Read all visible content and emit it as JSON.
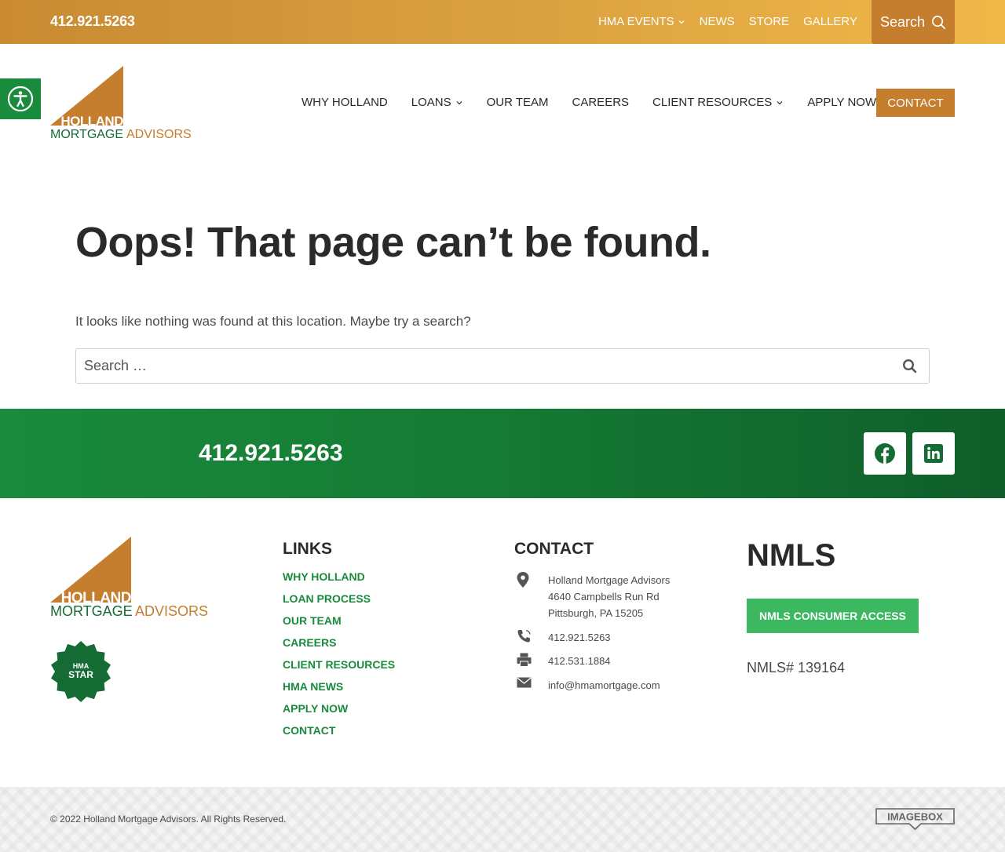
{
  "topbar": {
    "phone": "412.921.5263",
    "nav": [
      {
        "label": "HMA EVENTS",
        "has_dropdown": true
      },
      {
        "label": "NEWS",
        "has_dropdown": false
      },
      {
        "label": "STORE",
        "has_dropdown": false
      },
      {
        "label": "GALLERY",
        "has_dropdown": false
      }
    ],
    "search_label": "Search",
    "search_icon": "search-icon"
  },
  "header": {
    "logo": {
      "word1": "HOLLAND",
      "word2": "MORTGAGE",
      "word3": "ADVISORS"
    },
    "nav": [
      {
        "label": "WHY HOLLAND",
        "has_dropdown": false
      },
      {
        "label": "LOANS",
        "has_dropdown": true
      },
      {
        "label": "OUR TEAM",
        "has_dropdown": false
      },
      {
        "label": "CAREERS",
        "has_dropdown": false
      },
      {
        "label": "CLIENT RESOURCES",
        "has_dropdown": true
      },
      {
        "label": "APPLY NOW",
        "has_dropdown": false
      }
    ],
    "contact_label": "CONTACT",
    "accessibility_icon": "accessibility-icon"
  },
  "main": {
    "title": "Oops! That page can’t be found.",
    "text": "It looks like nothing was found at this location. Maybe try a search?",
    "search_placeholder": "Search …"
  },
  "band": {
    "phone": "412.921.5263",
    "social": [
      "facebook-icon",
      "linkedin-icon"
    ]
  },
  "footer": {
    "links_title": "LINKS",
    "links": [
      "WHY HOLLAND",
      "LOAN PROCESS",
      "OUR TEAM",
      "CAREERS",
      "CLIENT RESOURCES",
      "HMA NEWS",
      "APPLY NOW",
      "CONTACT"
    ],
    "contact_title": "CONTACT",
    "address": [
      "Holland Mortgage Advisors",
      "4640 Campbells Run Rd",
      "Pittsburgh, PA 15205"
    ],
    "phone": "412.921.5263",
    "fax": "412.531.1884",
    "email": "info@hmamortgage.com",
    "nmls_title": "NMLS",
    "nmls_button": "NMLS CONSUMER ACCESS",
    "nmls_number": "NMLS# 139164",
    "badge": {
      "line1": "HMA",
      "line2": "STAR"
    }
  },
  "bottom": {
    "copyright": "© 2022 Holland Mortgage Advisors. All Rights Reserved.",
    "credit": "IMAGEBOX"
  },
  "colors": {
    "gold": "#c47e2e",
    "green": "#1a8a3c",
    "light_green": "#3cb860",
    "dark_text": "#2a2a2a"
  }
}
